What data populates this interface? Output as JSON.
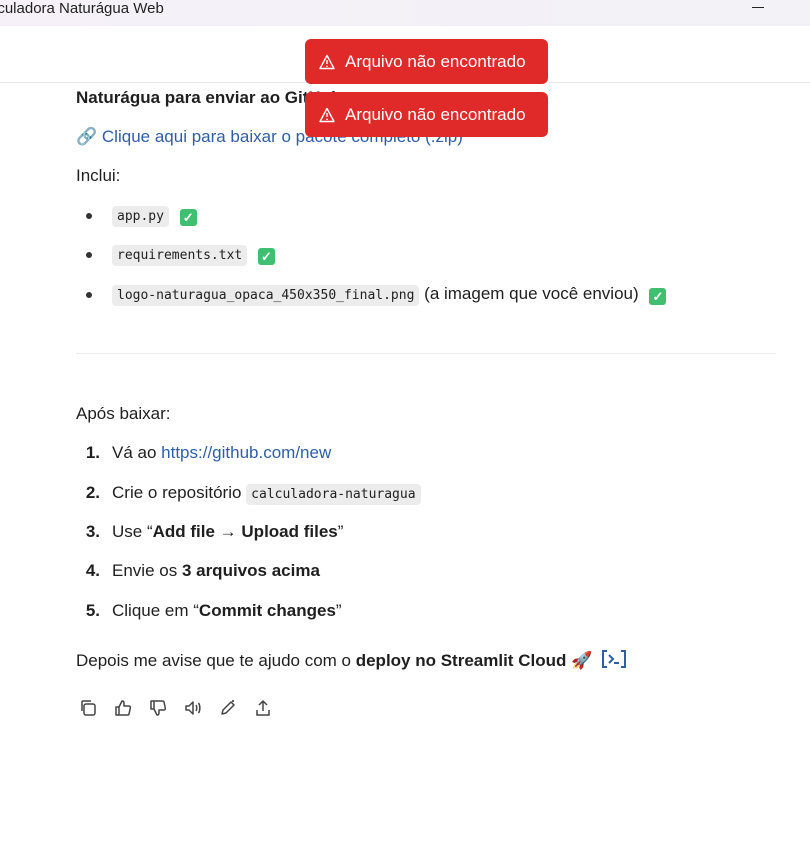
{
  "window": {
    "title": "lculadora Naturágua Web"
  },
  "toasts": [
    {
      "message": "Arquivo não encontrado"
    },
    {
      "message": "Arquivo não encontrado"
    }
  ],
  "message": {
    "heading_visible": "Naturágua para enviar ao GitHub",
    "download_link": "Clique aqui para baixar o pacote completo (.zip)",
    "includes_label": "Inclui:",
    "files": [
      {
        "name": "app.py",
        "note": ""
      },
      {
        "name": "requirements.txt",
        "note": ""
      },
      {
        "name": "logo-naturagua_opaca_450x350_final.png",
        "note": "(a imagem que você enviou)"
      }
    ],
    "after_label": "Após baixar:",
    "steps": [
      {
        "num": "1.",
        "pre": "Vá ao ",
        "link": "https://github.com/new"
      },
      {
        "num": "2.",
        "pre": "Crie o repositório ",
        "code": "calculadora-naturagua"
      },
      {
        "num": "3.",
        "pre": "Use “",
        "bold": "Add file → Upload files",
        "post": "”"
      },
      {
        "num": "4.",
        "pre": "Envie os ",
        "bold": "3 arquivos acima"
      },
      {
        "num": "5.",
        "pre": "Clique em “",
        "bold": "Commit changes",
        "post": "”"
      }
    ],
    "closing_pre": "Depois me avise que te ajudo com o ",
    "closing_bold": "deploy no Streamlit Cloud",
    "closing_emoji": "🚀"
  },
  "actions": [
    "copy-icon",
    "thumbs-up-icon",
    "thumbs-down-icon",
    "read-aloud-icon",
    "edit-icon",
    "share-icon"
  ],
  "colors": {
    "toast_bg": "#e02a2a",
    "link": "#2f5ea6",
    "check": "#3fbf6f"
  }
}
